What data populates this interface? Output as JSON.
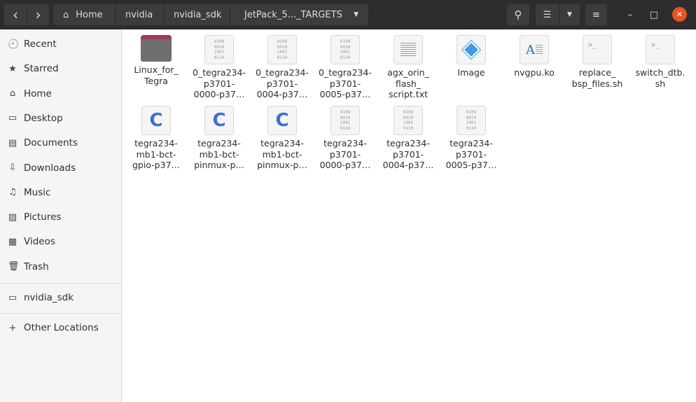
{
  "header": {
    "back": "‹",
    "forward": "›",
    "breadcrumbs": [
      "Home",
      "nvidia",
      "nvidia_sdk",
      "JetPack_5..._TARGETS"
    ],
    "window_controls": {
      "minimize": "–",
      "maximize": "□",
      "close": "✕"
    },
    "close_color": "#e95420"
  },
  "sidebar": {
    "items": [
      {
        "label": "Recent",
        "icon": "🕘"
      },
      {
        "label": "Starred",
        "icon": "★"
      },
      {
        "label": "Home",
        "icon": "⌂"
      },
      {
        "label": "Desktop",
        "icon": "▭"
      },
      {
        "label": "Documents",
        "icon": "▤"
      },
      {
        "label": "Downloads",
        "icon": "⇩"
      },
      {
        "label": "Music",
        "icon": "♫"
      },
      {
        "label": "Pictures",
        "icon": "▨"
      },
      {
        "label": "Videos",
        "icon": "▦"
      },
      {
        "label": "Trash",
        "icon": "🗑"
      }
    ],
    "bookmarks": [
      {
        "label": "nvidia_sdk",
        "icon": "▭"
      }
    ],
    "other": {
      "label": "Other Locations",
      "icon": "+"
    }
  },
  "files": [
    {
      "name": "Linux_for_\nTegra",
      "type": "folder"
    },
    {
      "name": "0_tegra234-\np3701-\n0000-p37…",
      "type": "binary"
    },
    {
      "name": "0_tegra234-\np3701-\n0004-p37…",
      "type": "binary"
    },
    {
      "name": "0_tegra234-\np3701-\n0005-p37…",
      "type": "binary"
    },
    {
      "name": "agx_orin_\nflash_\nscript.txt",
      "type": "text"
    },
    {
      "name": "Image",
      "type": "image"
    },
    {
      "name": "nvgpu.ko",
      "type": "doc"
    },
    {
      "name": "replace_\nbsp_files.sh",
      "type": "script"
    },
    {
      "name": "switch_dtb.\nsh",
      "type": "script"
    },
    {
      "name": "tegra234-\nmb1-bct-\ngpio-p37…",
      "type": "c"
    },
    {
      "name": "tegra234-\nmb1-bct-\npinmux-p…",
      "type": "c"
    },
    {
      "name": "tegra234-\nmb1-bct-\npinmux-p…",
      "type": "c"
    },
    {
      "name": "tegra234-\np3701-\n0000-p37…",
      "type": "binary"
    },
    {
      "name": "tegra234-\np3701-\n0004-p37…",
      "type": "binary"
    },
    {
      "name": "tegra234-\np3701-\n0005-p37…",
      "type": "binary"
    }
  ],
  "icon_glyphs": {
    "binary": "0100\n0010\n1001\n0110",
    "c": "C",
    "script": ">_",
    "doc": "A"
  }
}
